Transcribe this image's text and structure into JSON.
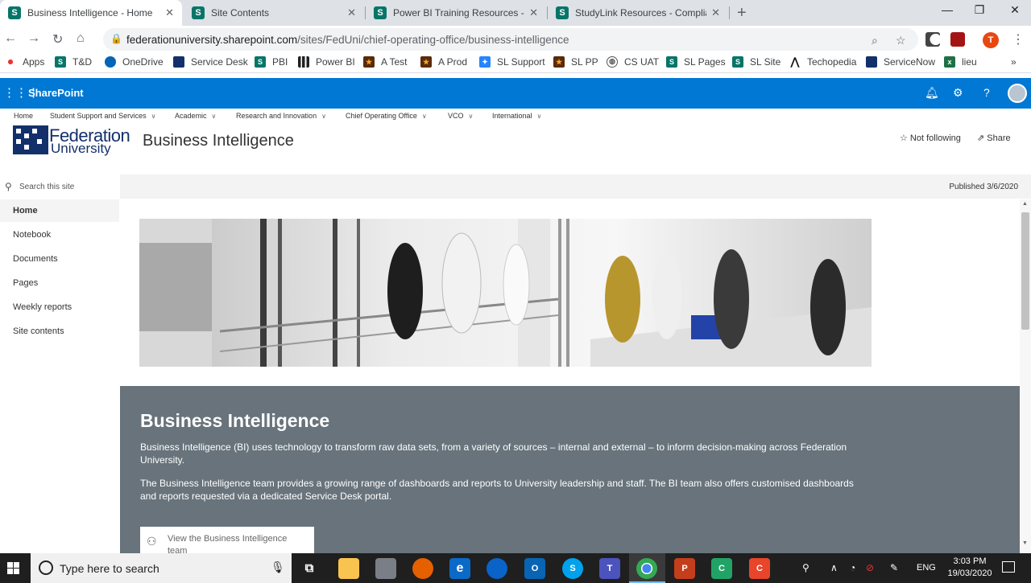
{
  "browser": {
    "tabs": [
      {
        "title": "Business Intelligence - Home",
        "active": true
      },
      {
        "title": "Site Contents",
        "active": false
      },
      {
        "title": "Power BI Training Resources - Ho",
        "active": false
      },
      {
        "title": "StudyLink Resources - Complianc",
        "active": false
      }
    ],
    "new_tab": "+",
    "window": {
      "minimize": "—",
      "restore": "❐",
      "close": "✕"
    },
    "url_host": "federationuniversity.sharepoint.com",
    "url_path": "/sites/FedUni/chief-operating-office/business-intelligence",
    "profile_initial": "T",
    "bookmarks": [
      "Apps",
      "T&D",
      "OneDrive",
      "Service Desk",
      "PBI",
      "Power BI",
      "A Test",
      "A Prod",
      "SL Support",
      "SL PP",
      "CS UAT",
      "SL Pages",
      "SL Site",
      "Techopedia",
      "ServiceNow",
      "lieu"
    ],
    "bookmarks_overflow": "»"
  },
  "suitebar": {
    "app_name": "SharePoint",
    "icons": [
      "waffle-icon",
      "bell-icon",
      "gear-icon",
      "help-icon"
    ]
  },
  "hub_nav": [
    "Home",
    "Student Support and Services",
    "Academic",
    "Research and Innovation",
    "Chief Operating Office",
    "VCO",
    "International"
  ],
  "site": {
    "logo_line1": "Federation",
    "logo_line2": "University",
    "title": "Business Intelligence",
    "follow_label": "Not following",
    "share_label": "Share"
  },
  "left_nav": {
    "search_placeholder": "Search this site",
    "items": [
      "Home",
      "Notebook",
      "Documents",
      "Pages",
      "Weekly reports",
      "Site contents"
    ],
    "active": "Home"
  },
  "page": {
    "published": "Published 3/6/2020",
    "heading": "Business Intelligence",
    "para1": "Business Intelligence (BI) uses technology to transform raw data sets, from a variety of sources – internal and external – to inform decision-making across Federation University.",
    "para2": "The Business Intelligence team provides a growing range of dashboards and reports to University leadership and staff.  The BI team also offers customised dashboards and reports requested via a dedicated Service Desk portal.",
    "view_button": "View the Business Intelligence team"
  },
  "taskbar": {
    "search_placeholder": "Type here to search",
    "language": "ENG",
    "time": "3:03 PM",
    "date": "19/03/2020"
  },
  "colors": {
    "sharepoint_blue": "#0078d4",
    "section_gray": "#68737b",
    "feduni_navy": "#14306b"
  }
}
